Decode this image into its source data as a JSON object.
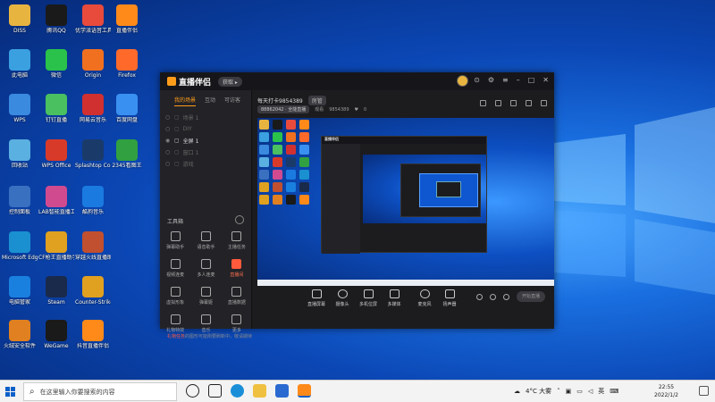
{
  "desktop": {
    "icons": [
      {
        "label": "DISS",
        "color": "#e8b440"
      },
      {
        "label": "腾讯QQ",
        "color": "#1a1a1a"
      },
      {
        "label": "优学派语音工具",
        "color": "#e84a3c"
      },
      {
        "label": "直播伴侣",
        "color": "#ff8a1a"
      },
      {
        "label": "此电脑",
        "color": "#3aa0e0"
      },
      {
        "label": "微信",
        "color": "#2ac24a"
      },
      {
        "label": "Origin",
        "color": "#f07020"
      },
      {
        "label": "Firefox",
        "color": "#ff6a2a"
      },
      {
        "label": "WPS",
        "color": "#3a8ae0"
      },
      {
        "label": "钉钉直播",
        "color": "#4ac060"
      },
      {
        "label": "网易云音乐",
        "color": "#d03030"
      },
      {
        "label": "百度网盘",
        "color": "#3a90f0"
      },
      {
        "label": "回收站",
        "color": "#5ab0e0"
      },
      {
        "label": "WPS Office",
        "color": "#d83a2a"
      },
      {
        "label": "Splashtop Connect",
        "color": "#1a3a6a"
      },
      {
        "label": "2345看图王",
        "color": "#30a040"
      },
      {
        "label": "控制面板",
        "color": "#3a70c0"
      },
      {
        "label": "LAB智能直播工具",
        "color": "#d04a90"
      },
      {
        "label": "酷狗音乐",
        "color": "#1a7ae0"
      },
      {
        "label": "",
        "color": "#000000"
      },
      {
        "label": "Microsoft Edge",
        "color": "#1a90d0"
      },
      {
        "label": "CF枪王直播助手",
        "color": "#e0a020"
      },
      {
        "label": "穿越火线直播助手",
        "color": "#c05030"
      },
      {
        "label": "",
        "color": "#000000"
      },
      {
        "label": "电脑管家",
        "color": "#1a80e0"
      },
      {
        "label": "Steam",
        "color": "#1a2a4a"
      },
      {
        "label": "Counter-Strike Global Offensive",
        "color": "#e0a020"
      },
      {
        "label": "",
        "color": "#000000"
      },
      {
        "label": "火绒安全软件",
        "color": "#e08020"
      },
      {
        "label": "WeGame",
        "color": "#1a1a1a"
      },
      {
        "label": "抖音直播伴侣",
        "color": "#ff8a1a"
      }
    ]
  },
  "app": {
    "name": "直播伴侣",
    "version_btn": "获取 ▸",
    "left_tabs": [
      "我的场景",
      "互动",
      "可访客"
    ],
    "scenes": [
      {
        "label": "场景 1",
        "active": false
      },
      {
        "label": "DIY",
        "active": false
      },
      {
        "label": "全屏 1",
        "active": true
      },
      {
        "label": "窗口 1",
        "active": false
      },
      {
        "label": "游戏",
        "active": false
      }
    ],
    "tools_title": "工具箱",
    "tools": [
      {
        "label": "弹幕助手",
        "hot": false
      },
      {
        "label": "语音助手",
        "hot": false
      },
      {
        "label": "主播任务",
        "hot": false
      },
      {
        "label": "视频连麦",
        "hot": false
      },
      {
        "label": "多人连麦",
        "hot": false
      },
      {
        "label": "直播间",
        "hot": true
      },
      {
        "label": "虚拟形象",
        "hot": false
      },
      {
        "label": "弹幕姬",
        "hot": false
      },
      {
        "label": "直播数据",
        "hot": false
      },
      {
        "label": "礼物特效",
        "hot": false
      },
      {
        "label": "音乐",
        "hot": false
      },
      {
        "label": "更多",
        "hot": false
      }
    ],
    "notice_red": "礼物任务",
    "notice_text": "的图形可能刚要刷新中，敬请期待",
    "room_name": "每天打卡9854389",
    "room_badge": "房管",
    "room_id_label": "88862042 · 全能直播",
    "room_view_label": "观看",
    "room_view_count": "9854389",
    "room_fans": "0",
    "controls": [
      "直播屏幕",
      "摄像头",
      "多机位屏",
      "多媒体",
      "麦克风",
      "扬声器"
    ],
    "live_btn": "开始直播"
  },
  "taskbar": {
    "search_placeholder": "在这里输入你要搜索的内容",
    "weather": "4°C 大雾",
    "lang": "英",
    "time": "22:55",
    "date": "2022/1/2"
  }
}
